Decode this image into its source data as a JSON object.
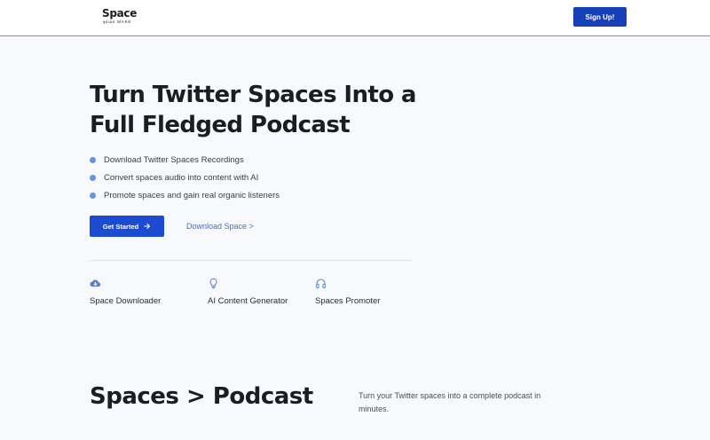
{
  "header": {
    "logo_main": "Space",
    "logo_sub": "ʞɒɯɒ MAKE",
    "signup_label": "Sign Up!"
  },
  "hero": {
    "title": "Turn Twitter Spaces Into a Full Fledged Podcast",
    "features": [
      "Download Twitter Spaces Recordings",
      "Convert spaces audio into content with AI",
      "Promote spaces and gain real organic listeners"
    ],
    "cta_label": "Get Started",
    "secondary_link": "Download Space >"
  },
  "tools": [
    {
      "icon": "cloud-download-icon",
      "label": "Space Downloader"
    },
    {
      "icon": "lightbulb-icon",
      "label": "AI Content Generator"
    },
    {
      "icon": "headphones-icon",
      "label": "Spaces Promoter"
    }
  ],
  "section2": {
    "title": "Spaces > Podcast",
    "description": "Turn your Twitter spaces into a complete podcast in minutes."
  },
  "colors": {
    "accent": "#1a4bd0",
    "signup": "#1640b8",
    "icon": "#5a7fc8",
    "bullet": "#6a93d8",
    "background": "#f8f9fc"
  }
}
